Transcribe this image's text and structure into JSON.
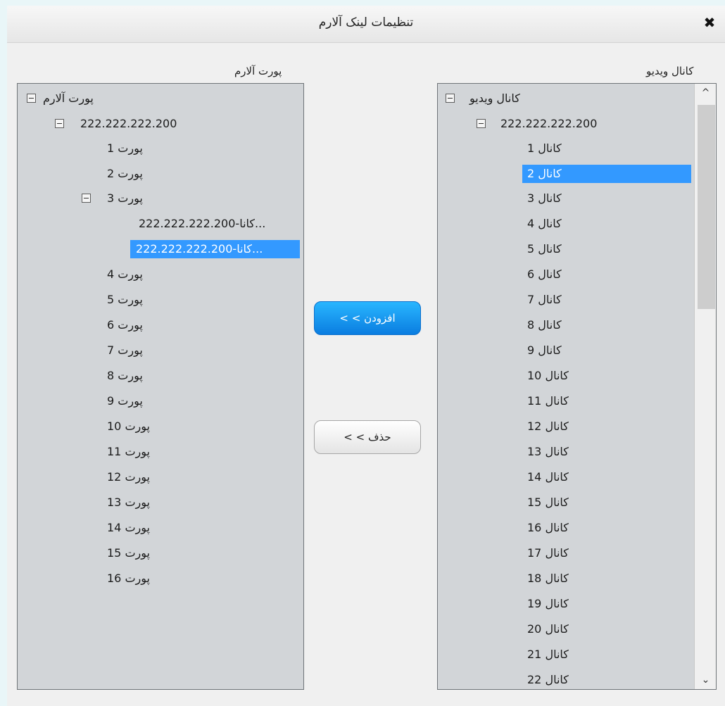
{
  "dialog": {
    "title": "تنظیمات لینک آلارم",
    "close_icon": "✖"
  },
  "left_panel": {
    "label": "پورت آلارم",
    "root": "پورت آلارم",
    "ip": "222.222.222.200",
    "ports": [
      "پورت 1",
      "پورت 2",
      "پورت 3",
      "پورت 4",
      "پورت 5",
      "پورت 6",
      "پورت 7",
      "پورت 8",
      "پورت 9",
      "پورت 10",
      "پورت 11",
      "پورت 12",
      "پورت 13",
      "پورت 14",
      "پورت 15",
      "پورت 16"
    ],
    "port3_children": [
      "222.222.222.200-کانا...",
      "222.222.222.200-کانا..."
    ]
  },
  "buttons": {
    "add": "< < افزودن",
    "remove": "< < حذف"
  },
  "right_panel": {
    "label": "کانال ویدیو",
    "root": "کانال ویدیو",
    "ip": "222.222.222.200",
    "channels": [
      "کانال 1",
      "کانال 2",
      "کانال 3",
      "کانال 4",
      "کانال 5",
      "کانال 6",
      "کانال 7",
      "کانال 8",
      "کانال 9",
      "کانال 10",
      "کانال 11",
      "کانال 12",
      "کانال 13",
      "کانال 14",
      "کانال 15",
      "کانال 16",
      "کانال 17",
      "کانال 18",
      "کانال 19",
      "کانال 20",
      "کانال 21",
      "کانال 22"
    ],
    "selected_index": 1,
    "scroll_up": "^",
    "scroll_down": "⌄"
  },
  "colors": {
    "selection": "#3399ff",
    "tree_bg": "#d2d5d8",
    "add_button": "#0a7de0"
  }
}
